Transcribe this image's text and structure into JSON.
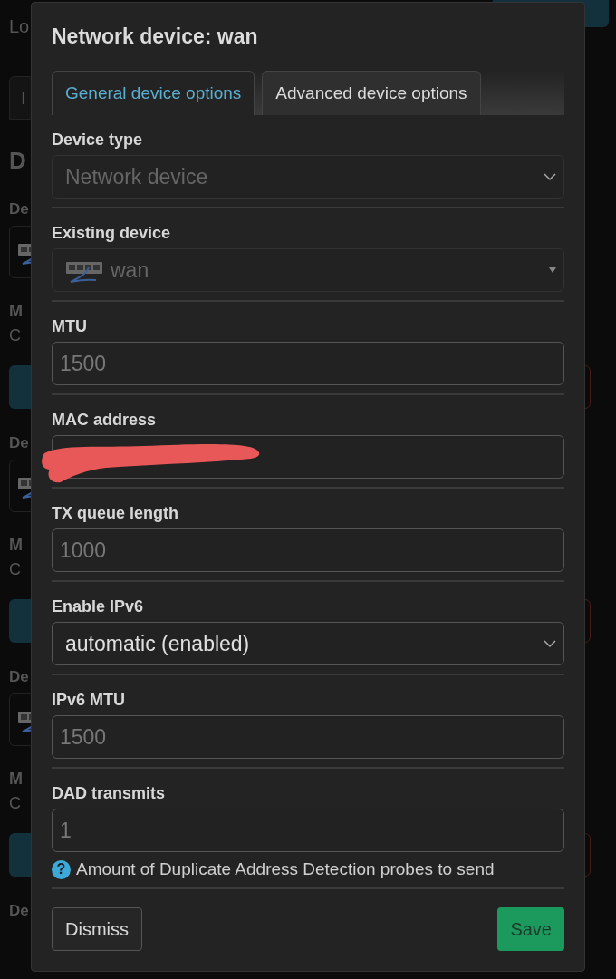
{
  "background": {
    "top_text": "Lo",
    "tab": "I",
    "heading": "D",
    "devices": [
      {
        "label": "De",
        "mac_label": "M",
        "mac_value": "C"
      },
      {
        "label": "De",
        "mac_label": "M",
        "mac_value": "C"
      },
      {
        "label": "De",
        "mac_label": "M",
        "mac_value": "C"
      }
    ],
    "last_label": "De"
  },
  "dialog": {
    "title": "Network device: wan",
    "tabs": [
      {
        "label": "General device options",
        "selected": true
      },
      {
        "label": "Advanced device options",
        "selected": false
      }
    ],
    "fields": [
      {
        "label": "Device type",
        "kind": "select",
        "value": "Network device",
        "disabled": true
      },
      {
        "label": "Existing device",
        "kind": "device-select",
        "value": "wan",
        "disabled": true
      },
      {
        "label": "MTU",
        "kind": "input",
        "placeholder": "1500"
      },
      {
        "label": "MAC address",
        "kind": "redacted"
      },
      {
        "label": "TX queue length",
        "kind": "input",
        "placeholder": "1000"
      },
      {
        "label": "Enable IPv6",
        "kind": "select",
        "value": "automatic (enabled)",
        "disabled": false
      },
      {
        "label": "IPv6 MTU",
        "kind": "input",
        "placeholder": "1500"
      },
      {
        "label": "DAD transmits",
        "kind": "input",
        "placeholder": "1",
        "help_mark": "?",
        "help": "Amount of Duplicate Address Detection probes to send"
      }
    ],
    "buttons": {
      "dismiss": "Dismiss",
      "save": "Save"
    }
  }
}
